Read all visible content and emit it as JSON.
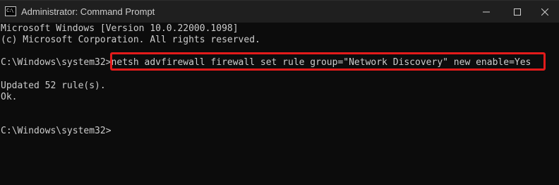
{
  "window": {
    "title": "Administrator: Command Prompt",
    "icon": "cmd-icon",
    "controls": [
      "minimize-icon",
      "maximize-icon",
      "close-icon"
    ]
  },
  "console": {
    "banner_line1": "Microsoft Windows [Version 10.0.22000.1098]",
    "banner_line2": "(c) Microsoft Corporation. All rights reserved.",
    "prompt": "C:\\Windows\\system32>",
    "command": "netsh advfirewall firewall set rule group=\"Network Discovery\" new enable=Yes",
    "output_line1": "Updated 52 rule(s).",
    "output_line2": "Ok.",
    "final_prompt": "C:\\Windows\\system32>"
  },
  "colors": {
    "background": "#0c0c0c",
    "text": "#cccccc",
    "highlight_border": "#e31b1b"
  }
}
